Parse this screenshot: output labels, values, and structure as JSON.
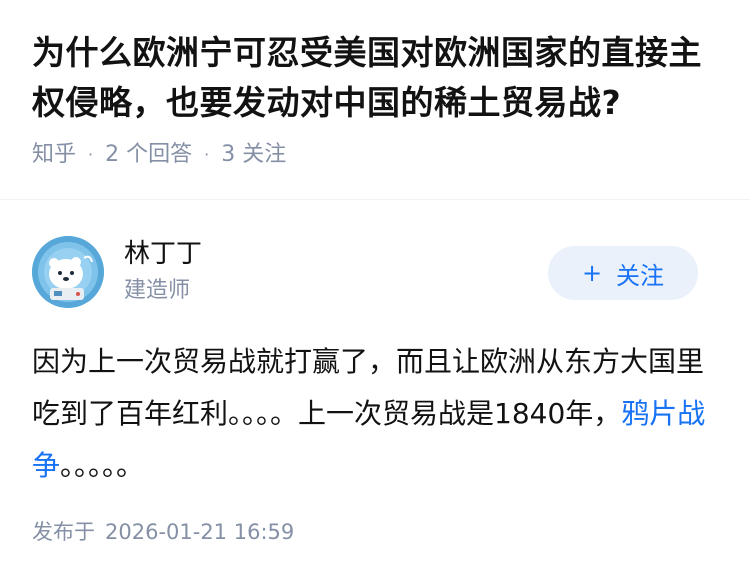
{
  "question": {
    "title": "为什么欧洲宁可忍受美国对欧洲国家的直接主权侵略，也要发动对中国的稀土贸易战?",
    "source": "知乎",
    "answers_count": "2 个回答",
    "followers_count": "3 关注"
  },
  "author": {
    "name": "林丁丁",
    "title": "建造师",
    "avatar_icon": "polar-bear-astronaut-avatar",
    "follow_label": "关注",
    "follow_icon": "plus-icon"
  },
  "answer": {
    "text_before_link": "因为上一次贸易战就打赢了，而且让欧洲从东方大国里吃到了百年红利。。。。上一次贸易战是1840年，",
    "link_text": "鸦片战争",
    "text_after_link": "。。。。。"
  },
  "footer": {
    "publish_label": "发布于",
    "publish_date": "2026-01-21 16:59"
  },
  "colors": {
    "link_blue": "#1772f6",
    "meta_gray": "#8590a6",
    "follow_bg": "#eaf1fb"
  }
}
